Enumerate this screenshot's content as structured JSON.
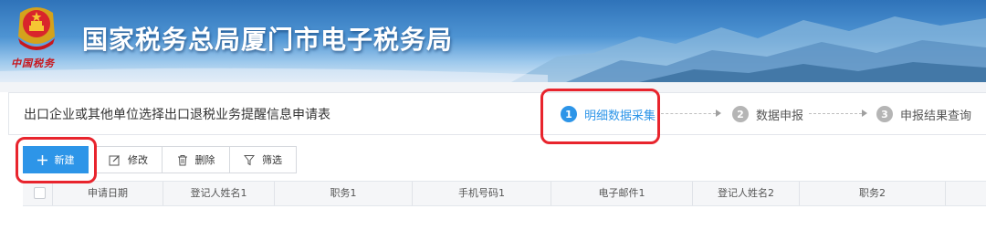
{
  "banner": {
    "title": "国家税务总局厦门市电子税务局",
    "brand": "中国税务"
  },
  "form": {
    "title": "出口企业或其他单位选择出口退税业务提醒信息申请表"
  },
  "steps": [
    {
      "num": "1",
      "label": "明细数据采集",
      "active": true
    },
    {
      "num": "2",
      "label": "数据申报",
      "active": false
    },
    {
      "num": "3",
      "label": "申报结果查询",
      "active": false
    }
  ],
  "toolbar": {
    "new_label": "新建",
    "edit_label": "修改",
    "delete_label": "删除",
    "filter_label": "筛选"
  },
  "table": {
    "columns": [
      "申请日期",
      "登记人姓名1",
      "职务1",
      "手机号码1",
      "电子邮件1",
      "登记人姓名2",
      "职务2"
    ]
  },
  "colors": {
    "accent": "#2d95e8",
    "highlight": "#e8242d",
    "step_inactive": "#b5b5b5"
  }
}
